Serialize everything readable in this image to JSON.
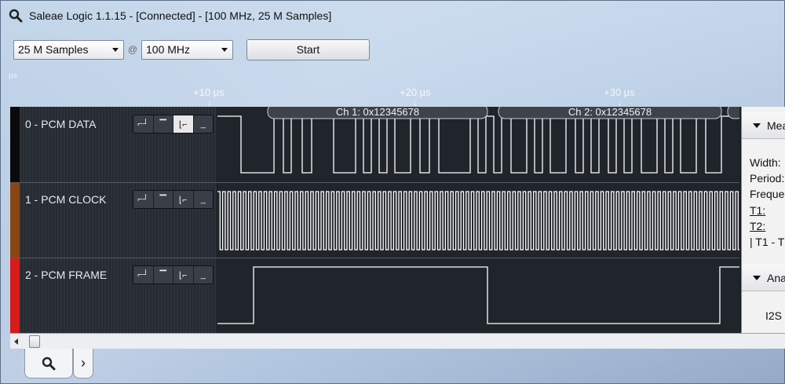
{
  "window": {
    "title": "Saleae Logic 1.1.15 - [Connected] - [100 MHz, 25 M Samples]"
  },
  "toolbar": {
    "samples_value": "25 M Samples",
    "at_sign": "@",
    "rate_value": "100 MHz",
    "start_label": "Start"
  },
  "ruler": {
    "unit": "µs",
    "ticks": [
      {
        "label": "+10 µs",
        "mark": "↓"
      },
      {
        "label": "+20 µs",
        "mark": "↓"
      },
      {
        "label": "+30 µs",
        "mark": "↓"
      }
    ]
  },
  "decode_bubbles": [
    {
      "label": "Ch 1: 0x12345678"
    },
    {
      "label": "Ch 2: 0x12345678"
    }
  ],
  "channels": [
    {
      "name": "0 - PCM DATA",
      "color": "#0a0a0a",
      "trigger_active": 2
    },
    {
      "name": "1 - PCM CLOCK",
      "color": "#8b4513",
      "trigger_active": -1
    },
    {
      "name": "2 - PCM FRAME",
      "color": "#d81b1b",
      "trigger_active": -1
    }
  ],
  "trigger_glyphs": [
    "⌐┘",
    "▔",
    "⌊⌐",
    "_"
  ],
  "right_panel": {
    "measurements_header": "Mea",
    "width_label": "Width:",
    "period_label": "Period:",
    "frequency_label": "Freque",
    "t1_label": "T1:",
    "t2_label": "T2:",
    "t1_t2_label": "| T1 - T",
    "analyzers_header": "Ana",
    "analyzer_item": "I2S ,"
  },
  "tabs": {
    "search_icon": "search-icon",
    "next_icon": "chevron-right-icon",
    "next_glyph": "›"
  },
  "colors": {
    "wave": "#ffffff",
    "waveform_bg": "#20242b"
  }
}
